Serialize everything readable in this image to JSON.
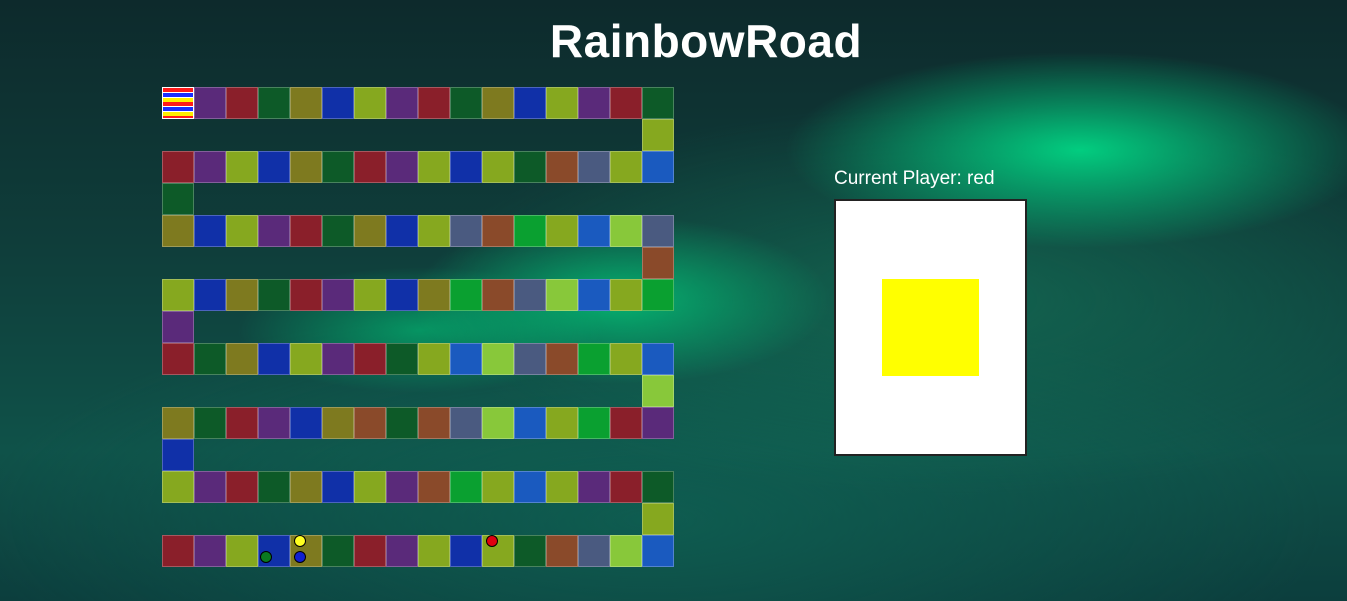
{
  "title": "RainbowRoad",
  "status": {
    "label_prefix": "Current Player:",
    "current_player": "red",
    "label": "Current Player: red"
  },
  "card": {
    "color": "#ffff00"
  },
  "board": {
    "palette": {
      "P": "#5a2a7a",
      "R": "#8a1f2a",
      "G": "#0d5a28",
      "O": "#7e7a1f",
      "B": "#1030a8",
      "L": "#86a81f",
      "M": "#1f7a30",
      "N": "#8a4a2a",
      "S": "#4a5a80",
      "K": "#1a5abf",
      "A": "#88c83a",
      "T": "#0aa030",
      "E": "#0f8a30",
      "Q": "#b0d04a"
    },
    "rows": [
      "XPRGOBLPRGOBLPRG",
      "RPLBOGRPLBLGNSLK",
      "OBLPRGOBLSNTLKAS",
      "LBOGRPLBOTNSAKLT",
      "RGOBLPRGLKASNTLK",
      "OGRPBONGNSAKLTRP",
      "LPRGOBLPNTLKLPRG",
      "RPLBOGRPLBLGNSAK"
    ],
    "connectors": [
      {
        "row": 0,
        "side": "right",
        "code": "L"
      },
      {
        "row": 1,
        "side": "left",
        "code": "G"
      },
      {
        "row": 2,
        "side": "right",
        "code": "N"
      },
      {
        "row": 3,
        "side": "left",
        "code": "P"
      },
      {
        "row": 4,
        "side": "right",
        "code": "A"
      },
      {
        "row": 5,
        "side": "left",
        "code": "B"
      },
      {
        "row": 6,
        "side": "right",
        "code": "L"
      }
    ],
    "pieces": [
      {
        "player": "green",
        "color": "#0a7a20",
        "row": 7,
        "col": 3,
        "slot": "bl"
      },
      {
        "player": "yellow",
        "color": "#ffff20",
        "row": 7,
        "col": 4,
        "slot": "tl"
      },
      {
        "player": "blue",
        "color": "#1020d0",
        "row": 7,
        "col": 4,
        "slot": "bl"
      },
      {
        "player": "red",
        "color": "#e00010",
        "row": 7,
        "col": 10,
        "slot": "tl"
      }
    ]
  }
}
